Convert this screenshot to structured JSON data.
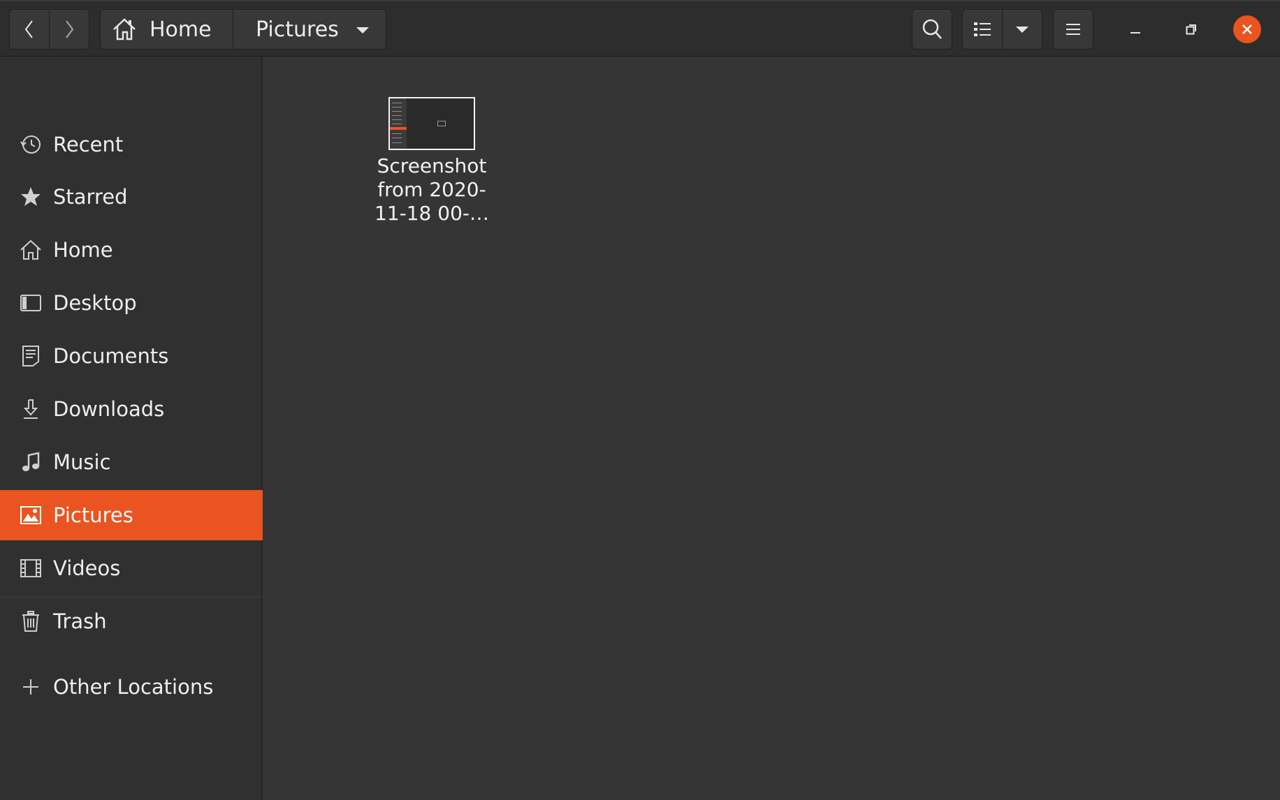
{
  "header": {
    "breadcrumb": {
      "home_label": "Home",
      "current_label": "Pictures"
    }
  },
  "sidebar": {
    "items": [
      {
        "label": "Recent",
        "icon": "recent-icon"
      },
      {
        "label": "Starred",
        "icon": "star-icon"
      },
      {
        "label": "Home",
        "icon": "home-icon"
      },
      {
        "label": "Desktop",
        "icon": "desktop-icon"
      },
      {
        "label": "Documents",
        "icon": "documents-icon"
      },
      {
        "label": "Downloads",
        "icon": "downloads-icon"
      },
      {
        "label": "Music",
        "icon": "music-icon"
      },
      {
        "label": "Pictures",
        "icon": "pictures-icon"
      },
      {
        "label": "Videos",
        "icon": "videos-icon"
      },
      {
        "label": "Trash",
        "icon": "trash-icon"
      }
    ],
    "active_item": "Pictures",
    "other_locations_label": "Other Locations"
  },
  "content": {
    "files": [
      {
        "name": "Screenshot from 2020-11-18 00-…",
        "type": "image"
      }
    ]
  },
  "colors": {
    "accent": "#e95420",
    "background": "#353535",
    "sidebar": "#303030",
    "headerbar": "#2d2d2d",
    "text": "#eeeeee"
  }
}
